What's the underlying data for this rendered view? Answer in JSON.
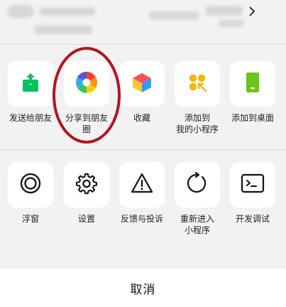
{
  "row1": [
    {
      "label": "发送给朋友",
      "icon": "share-arrow-icon",
      "color": "#07c160"
    },
    {
      "label": "分享到朋友\n圈",
      "icon": "moments-aperture-icon",
      "color": "#ff6b00"
    },
    {
      "label": "收藏",
      "icon": "favorites-cube-icon",
      "color": "#2ea5ff"
    },
    {
      "label": "添加到\n我的小程序",
      "icon": "mini-program-add-icon",
      "color": "#f2b400"
    },
    {
      "label": "添加到桌面",
      "icon": "desktop-phone-icon",
      "color": "#6cc51a"
    }
  ],
  "row2": [
    {
      "label": "浮窗",
      "icon": "float-window-icon"
    },
    {
      "label": "设置",
      "icon": "gear-icon"
    },
    {
      "label": "反馈与投诉",
      "icon": "warning-icon"
    },
    {
      "label": "重新进入\n小程序",
      "icon": "refresh-icon"
    },
    {
      "label": "开发调试",
      "icon": "terminal-icon"
    }
  ],
  "footer": {
    "cancel_label": "取消"
  }
}
